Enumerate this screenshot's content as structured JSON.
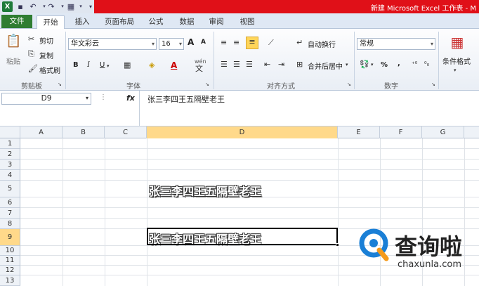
{
  "window": {
    "title": "新建 Microsoft Excel 工作表 - M"
  },
  "tabs": [
    {
      "label": "文件"
    },
    {
      "label": "开始"
    },
    {
      "label": "插入"
    },
    {
      "label": "页面布局"
    },
    {
      "label": "公式"
    },
    {
      "label": "数据"
    },
    {
      "label": "审阅"
    },
    {
      "label": "视图"
    }
  ],
  "clipboard": {
    "paste": "粘贴",
    "cut": "剪切",
    "copy": "复制",
    "format_painter": "格式刷",
    "label": "剪贴板"
  },
  "font": {
    "name": "华文彩云",
    "size": "16",
    "grow": "A",
    "shrink": "A",
    "bold": "B",
    "italic": "I",
    "underline": "U",
    "color_letter": "A",
    "wen": "wén",
    "label": "字体"
  },
  "alignment": {
    "wrap": "自动换行",
    "merge": "合并后居中",
    "label": "对齐方式"
  },
  "number": {
    "format": "常规",
    "percent": "%",
    "comma": ",",
    "label": "数字"
  },
  "styles": {
    "conditional": "条件格式"
  },
  "formula_bar": {
    "name_box": "D9",
    "fx": "fx",
    "content": "张三李四王五隔壁老王"
  },
  "columns": [
    "A",
    "B",
    "C",
    "D",
    "E",
    "F",
    "G"
  ],
  "rows": [
    "1",
    "2",
    "3",
    "4",
    "5",
    "6",
    "7",
    "8",
    "9",
    "10",
    "11",
    "12",
    "13"
  ],
  "cells": {
    "D5": "张三李四王五隔壁老王",
    "D9": "张三李四王五隔壁老王"
  },
  "watermark": {
    "name": "查询啦",
    "url": "chaxunla.com"
  },
  "colors": {
    "accent_red": "#e01018",
    "file_tab": "#2f7d32",
    "selection": "#ffd98a",
    "watermark_blue": "#1a7fd6",
    "watermark_orange": "#f59a1b"
  }
}
